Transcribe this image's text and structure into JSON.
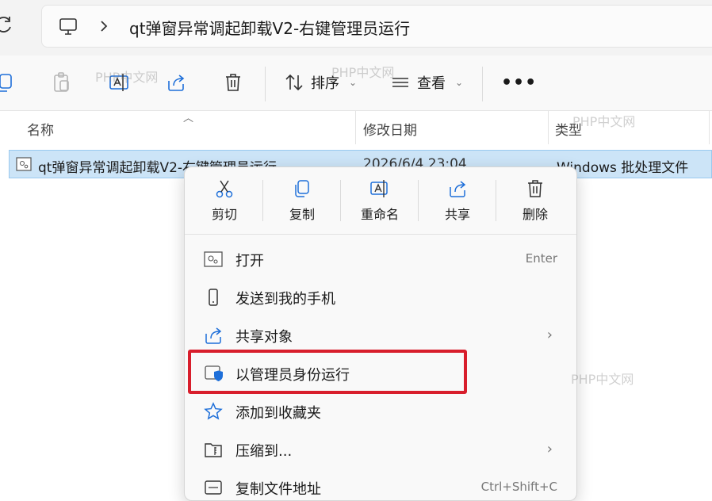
{
  "address": {
    "path_segment": "qt弹窗异常调起卸载V2-右键管理员运行"
  },
  "toolbar": {
    "sort_label": "排序",
    "view_label": "查看",
    "more_label": "•••"
  },
  "columns": {
    "name": "名称",
    "modified": "修改日期",
    "type": "类型"
  },
  "file": {
    "name": "qt弹窗异常调起卸载V2-右键管理员运行",
    "date": "2026/6/4 23:04",
    "type": "Windows 批处理文件"
  },
  "context_menu": {
    "quick_actions": [
      {
        "label": "剪切"
      },
      {
        "label": "复制"
      },
      {
        "label": "重命名"
      },
      {
        "label": "共享"
      },
      {
        "label": "删除"
      }
    ],
    "items": [
      {
        "label": "打开",
        "shortcut": "Enter"
      },
      {
        "label": "发送到我的手机"
      },
      {
        "label": "共享对象"
      },
      {
        "label": "以管理员身份运行"
      },
      {
        "label": "添加到收藏夹"
      },
      {
        "label": "压缩到..."
      },
      {
        "label": "复制文件地址",
        "shortcut": "Ctrl+Shift+C"
      }
    ]
  },
  "watermark": "PHP中文网",
  "colors": {
    "highlight_border": "#d81e2c",
    "selection": "#cce4f7"
  }
}
